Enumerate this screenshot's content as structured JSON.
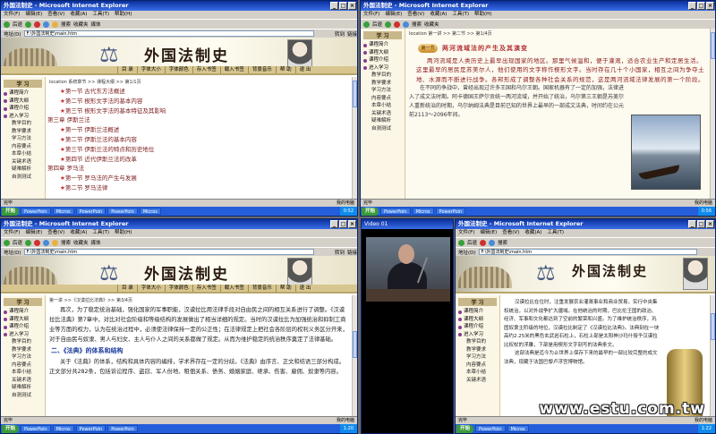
{
  "ie": {
    "title": "外国法制史 - Microsoft Internet Explorer",
    "menus": [
      "文件(F)",
      "编辑(E)",
      "查看(V)",
      "收藏(A)",
      "工具(T)",
      "帮助(H)"
    ],
    "toolbar": [
      "后退",
      "搜索",
      "收藏夹",
      "媒体"
    ],
    "address_label": "地址(D)",
    "address": "F:\\外国法制史\\main.htm",
    "go": "转到",
    "links": "链接",
    "status_done": "完毕",
    "status_zone": "我的电脑"
  },
  "site": {
    "title": "外国法制史",
    "nav": [
      "目 录",
      "字体大小",
      "字体颜色",
      "存入书签",
      "载入书签",
      "背景音乐",
      "帮 助",
      "退 出"
    ]
  },
  "sidebar": {
    "header": "学 习",
    "items": [
      "课程简介",
      "课程大纲",
      "课程介绍",
      "进入学习"
    ],
    "subs": [
      "教学目的",
      "教学要求",
      "学习方法",
      "内容要点",
      "本章小结",
      "关键术语",
      "疑难解析",
      "自测测试"
    ],
    "short_items": [
      "课程简介",
      "课程大纲",
      "课程介绍",
      "进入学习"
    ]
  },
  "win_tl": {
    "location": "location 系统章节 >> 课程大纲 >> 第1/1页",
    "toc": [
      {
        "type": "section",
        "text": "第一节  古代东方法概述"
      },
      {
        "type": "section",
        "text": "第二节  楔形文字法的基本内容"
      },
      {
        "type": "section",
        "text": "第三节  楔形文字法的基本特征及其影响"
      },
      {
        "type": "chapter",
        "text": "第三章  伊斯兰法"
      },
      {
        "type": "section",
        "text": "第一节  伊斯兰法概述"
      },
      {
        "type": "section",
        "text": "第二节  伊斯兰法的基本内容"
      },
      {
        "type": "section",
        "text": "第三节  伊斯兰法的特点和历史地位"
      },
      {
        "type": "section",
        "text": "第四节  近代伊斯兰法的改革"
      },
      {
        "type": "chapter",
        "text": "第四章  罗马法"
      },
      {
        "type": "section",
        "text": "第一节  罗马法的产生与发展"
      },
      {
        "type": "section",
        "text": "第二节  罗马法律"
      }
    ],
    "taskbar": [
      "开始",
      "PowerPoin",
      "Micros",
      "PowerPoin",
      "PowerPoin",
      "Micros"
    ],
    "clock": "0:52"
  },
  "win_tr": {
    "location": "location 第一讲 >> 第二节 >> 第1/4页",
    "lesson_tag": "第一节",
    "lesson_title": "两河流域法的产生及其演变",
    "para1": "两河流域是人类历史上最早出现国家的地区。那里气候温和，便于灌溉，适合农业生产和定居生活。这里最早的居民是苏美尔人，他们使用的文字称作楔形文字。当时存在几十个小国家，相互之间为争夺土地、水源而不断进行战争。各邦形成了调整各种社会关系的规范，这是两河流域法律发展的第一个阶段。",
    "para2": "在不同的争战中，曾经出现过许多王国和乌尔王朝。国家机器有了一定的加强，法律进入了成文法时期。阿卡德国王萨尔贡统一两河流域，并开始了统治，乌尔第三王朝是苏美尔人重新统治的时期，乌尔纳姆法典是目前已知的世界上最早的一部成文法典，时间约在公元前2113～2096年间。",
    "clock": "0:56"
  },
  "win_bl": {
    "location": "第一讲 >>《汉谟拉比法典》>> 第3/4页",
    "para1": "再次，为了稳定统治基础，强化国家的军事职能，汉谟拉比用法律手段对自由民之间的相互关系进行了调整。《汉谟拉比法典》第7章中，对比对社会阶级和等级结构的发展做出了相当详细的规定。当时的汉谟拉比为加强统治和抑制工商业等方面的权力，认为在统治过程中，必须使法律保持一定的公正性；在法律规定上把社会各阶层的权利义务区分开来，对于自由民与奴隶、男人与妇女、主人与仆人之间的关系都做了规定。从而为维护稳定的统治秩序奠定了法律基础。",
    "section": "二、《法典》的体系和结构",
    "para2": "关于《法典》的体系，结构和具体内容的编排，学术界存在一定的分歧。《法典》由序言、正文和结语三部分构成。正文部分共282条，包括诉讼程序、盗窃、军人份地、租佃关系、债务、婚姻家庭、继承、伤害、雇佣、奴隶等内容。",
    "clock": "1:20"
  },
  "video": {
    "title": "Video 01"
  },
  "win_br": {
    "para1": "汉谟拉比在位时，注重发展农业灌溉事业和商业贸易，实行中央集权统治，以对外战争扩大疆域。在他统治的时期，巴比伦王国的政治、经济、军事和文化都达到了空前的繁荣和兴盛。为了维护统治秩序，巩固奴隶主阶级的地位，汉谟拉比制定了《汉谟拉比法典》。法典刻在一块高约2.25米的黑色玄武岩石柱上，石柱上部是太阳神沙玛什授予汉谟拉比权杖的浮雕，下部是用楔形文字刻写的法典条文。",
    "para2": "这部法典是迄今为止世界上保存下来的最早的一部比较完整的成文法典，现藏于法国巴黎卢浮宫博物馆。",
    "clock": "1:22"
  },
  "watermark": "www.estu.com.tw"
}
